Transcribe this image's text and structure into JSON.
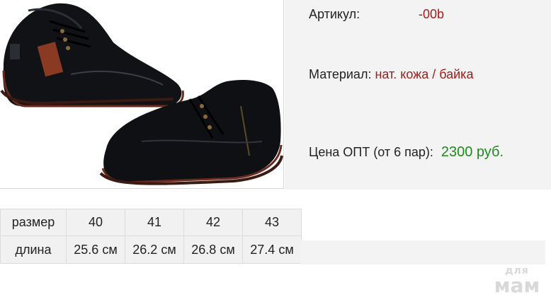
{
  "product_image": {
    "alt": "shoe-photo"
  },
  "info": {
    "article_label": "Артикул:",
    "article_value": "-00b",
    "material_label": "Материал:",
    "material_value": "нат. кожа / байка",
    "price_label": "Цена ОПТ (от 6 пар):",
    "price_value": "2300 руб."
  },
  "sizes": {
    "header_label": "размер",
    "length_label": "длина",
    "columns": [
      {
        "size": "40",
        "length": "25.6 см"
      },
      {
        "size": "41",
        "length": "26.2 см"
      },
      {
        "size": "42",
        "length": "26.8 см"
      },
      {
        "size": "43",
        "length": "27.4 см"
      }
    ]
  },
  "watermark": {
    "line1": "для",
    "line2": "мам"
  },
  "colors": {
    "accent_red": "#a31b1b",
    "price_green": "#1e8a1e",
    "panel_bg": "#f3f3f3"
  }
}
